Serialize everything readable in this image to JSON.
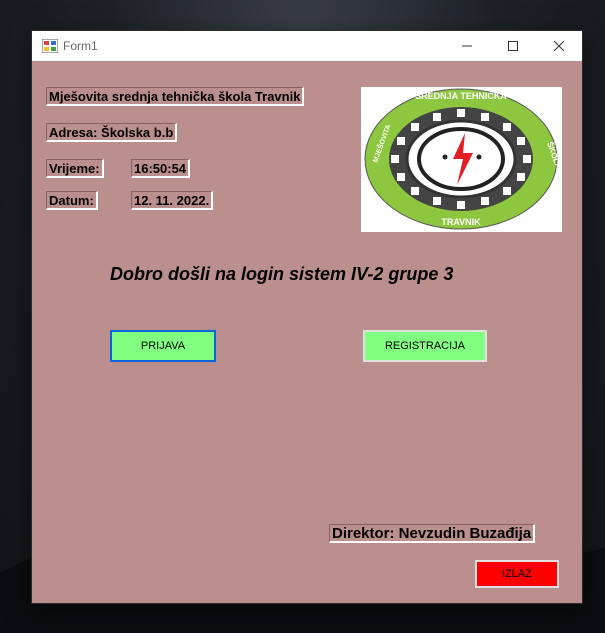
{
  "window": {
    "title": "Form1"
  },
  "labels": {
    "school": "Mješovita srednja tehnička škola Travnik",
    "address": "Adresa: Školska b.b",
    "time_label": "Vrijeme:",
    "time_value": "16:50:54",
    "date_label": "Datum:",
    "date_value": "12. 11. 2022.",
    "welcome": "Dobro došli na login sistem IV-2 grupe 3",
    "director": "Direktor: Nevzudin Buzađija"
  },
  "logo": {
    "ring_text_top": "SREDNJA TEHNIČKA",
    "left": "MJEŠOVITA",
    "right": "ŠKOLA",
    "bottom": "TRAVNIK",
    "ring_color": "#8dc63f"
  },
  "buttons": {
    "prijava": "PRIJAVA",
    "registracija": "REGISTRACIJA",
    "izlaz": "IZLAZ"
  },
  "colors": {
    "form_bg": "#bc8f8f",
    "button_green": "#80ff80",
    "exit_red": "#ff0000",
    "focus_border": "#0a64d8"
  }
}
